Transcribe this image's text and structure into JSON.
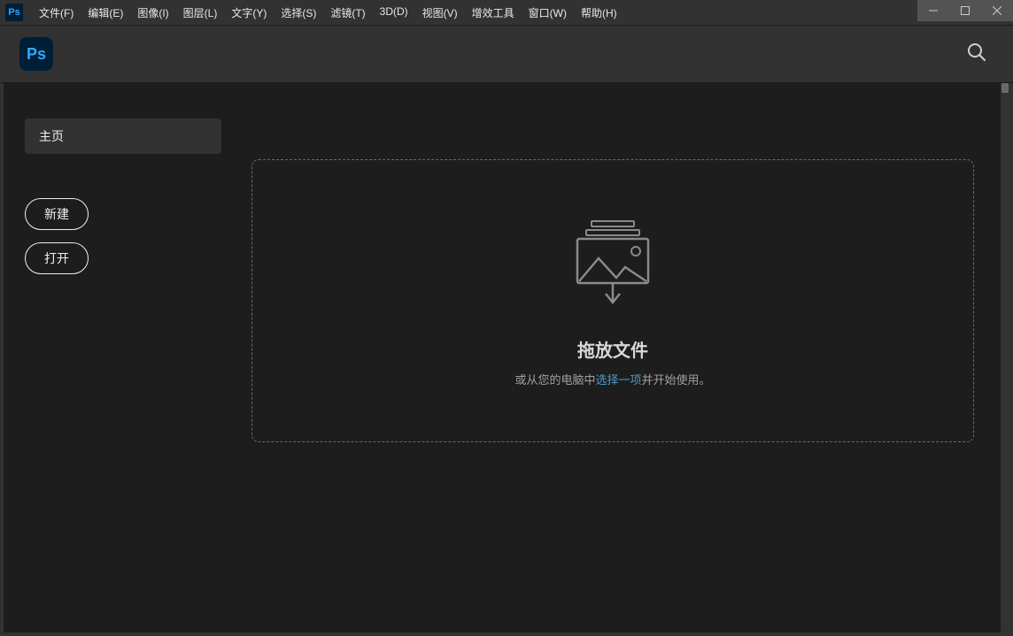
{
  "app": {
    "shortIcon": "Ps",
    "logoText": "Ps"
  },
  "menubar": {
    "items": [
      "文件(F)",
      "编辑(E)",
      "图像(I)",
      "图层(L)",
      "文字(Y)",
      "选择(S)",
      "滤镜(T)",
      "3D(D)",
      "视图(V)",
      "增效工具",
      "窗口(W)",
      "帮助(H)"
    ]
  },
  "sidebar": {
    "homeTab": "主页",
    "newButton": "新建",
    "openButton": "打开"
  },
  "dropZone": {
    "title": "拖放文件",
    "prefix": "或从您的电脑中",
    "linkText": "选择一项",
    "suffix": "并开始使用。"
  }
}
